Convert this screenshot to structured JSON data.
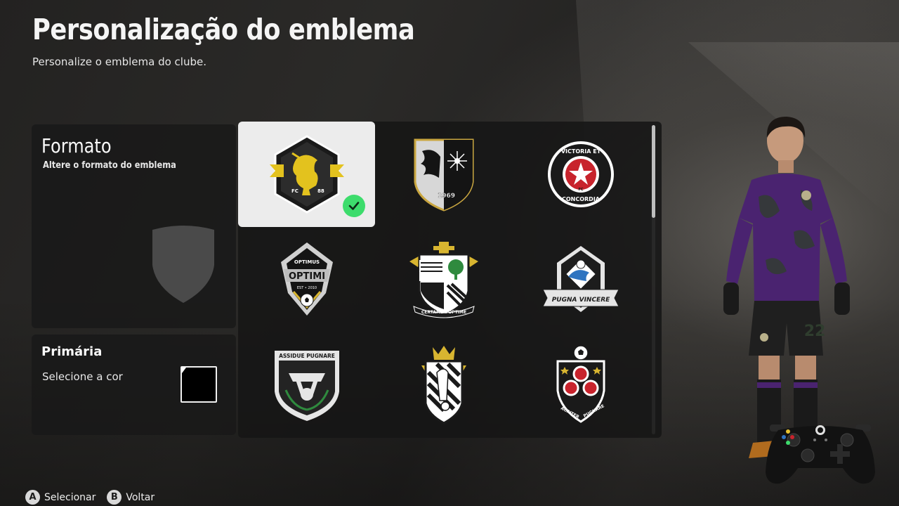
{
  "header": {
    "title": "Personalização do emblema",
    "subtitle": "Personalize o emblema do clube."
  },
  "format_panel": {
    "heading": "Formato",
    "description": "Altere o formato do emblema"
  },
  "primary_panel": {
    "heading": "Primária",
    "description": "Selecione a cor",
    "swatch_colors": [
      "#ffffff",
      "#000000"
    ]
  },
  "crests": [
    {
      "label": "FC 88",
      "selected": true
    },
    {
      "label": "1969",
      "selected": false
    },
    {
      "label": "VICTORIA ET CONCORDIA",
      "label_top": "VICTORIA ET",
      "label_bottom": "CONCORDIA",
      "label_small": "FC",
      "selected": false
    },
    {
      "label_top": "OPTIMUS",
      "label_main": "OPTIMI",
      "label_small": "EST • 2010",
      "selected": false
    },
    {
      "label": "CERTAMEN OPTIME",
      "selected": false
    },
    {
      "label": "PUGNA VINCERE",
      "selected": false
    },
    {
      "label": "ASSIDUE PUGNARE",
      "selected": false
    },
    {
      "label": "",
      "selected": false
    },
    {
      "label_left": "ACRITER",
      "label_right": "PUGNARE",
      "selected": false
    }
  ],
  "player": {
    "kit_number": "22",
    "kit_color": "#4a2370"
  },
  "footer": {
    "hints": [
      {
        "glyph": "A",
        "label": "Selecionar"
      },
      {
        "glyph": "B",
        "label": "Voltar"
      }
    ]
  },
  "colors": {
    "accent_check": "#3ddc6c",
    "selected_tile": "#ececec"
  }
}
